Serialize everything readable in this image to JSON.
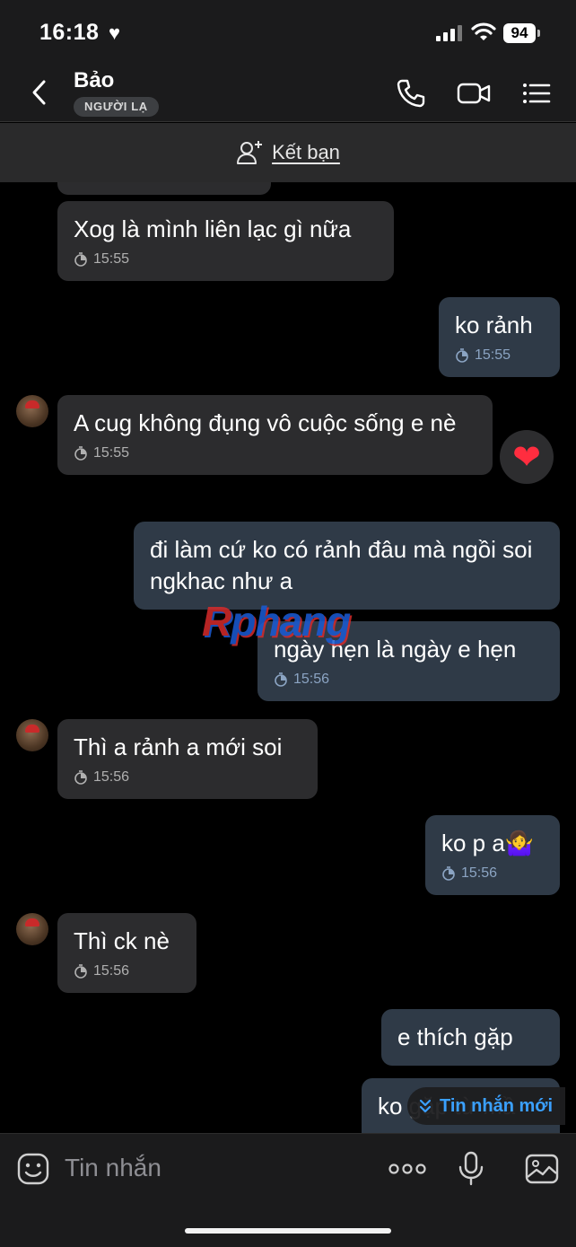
{
  "status": {
    "time": "16:18",
    "battery": "94"
  },
  "header": {
    "name": "Bảo",
    "badge": "NGƯỜI LẠ"
  },
  "friend_bar": {
    "label": "Kết bạn"
  },
  "messages": [
    {
      "dir": "in",
      "text": "Xog là mình liên lạc gì nữa",
      "time": "15:55"
    },
    {
      "dir": "out",
      "text": "ko rảnh",
      "time": "15:55"
    },
    {
      "dir": "in",
      "text": "A cug không đụng vô cuộc sống e nè",
      "time": "15:55",
      "reaction": "❤"
    },
    {
      "dir": "out",
      "text": "đi làm cứ ko có rảnh đâu mà ngồi soi ngkhac như a"
    },
    {
      "dir": "out",
      "text": "ngày hẹn là ngày e hẹn",
      "time": "15:56"
    },
    {
      "dir": "in",
      "text": "Thì a rảnh a mới soi",
      "time": "15:56"
    },
    {
      "dir": "out",
      "text": "ko p a🤷‍♀️",
      "time": "15:56"
    },
    {
      "dir": "in",
      "text": "Thì ck nè",
      "time": "15:56"
    },
    {
      "dir": "out",
      "text": "e thích gặp"
    },
    {
      "dir": "out",
      "text": "ko gặp từ mầ"
    }
  ],
  "watermark": {
    "r": "R",
    "rest": "phang"
  },
  "new_message": {
    "label": "Tin nhắn mới"
  },
  "composer": {
    "placeholder": "Tin nhắn"
  },
  "colors": {
    "accent": "#3aa0ff",
    "bubble_in": "#2c2c2e",
    "bubble_out": "#2f3a47",
    "reaction": "#ff2d3f"
  }
}
